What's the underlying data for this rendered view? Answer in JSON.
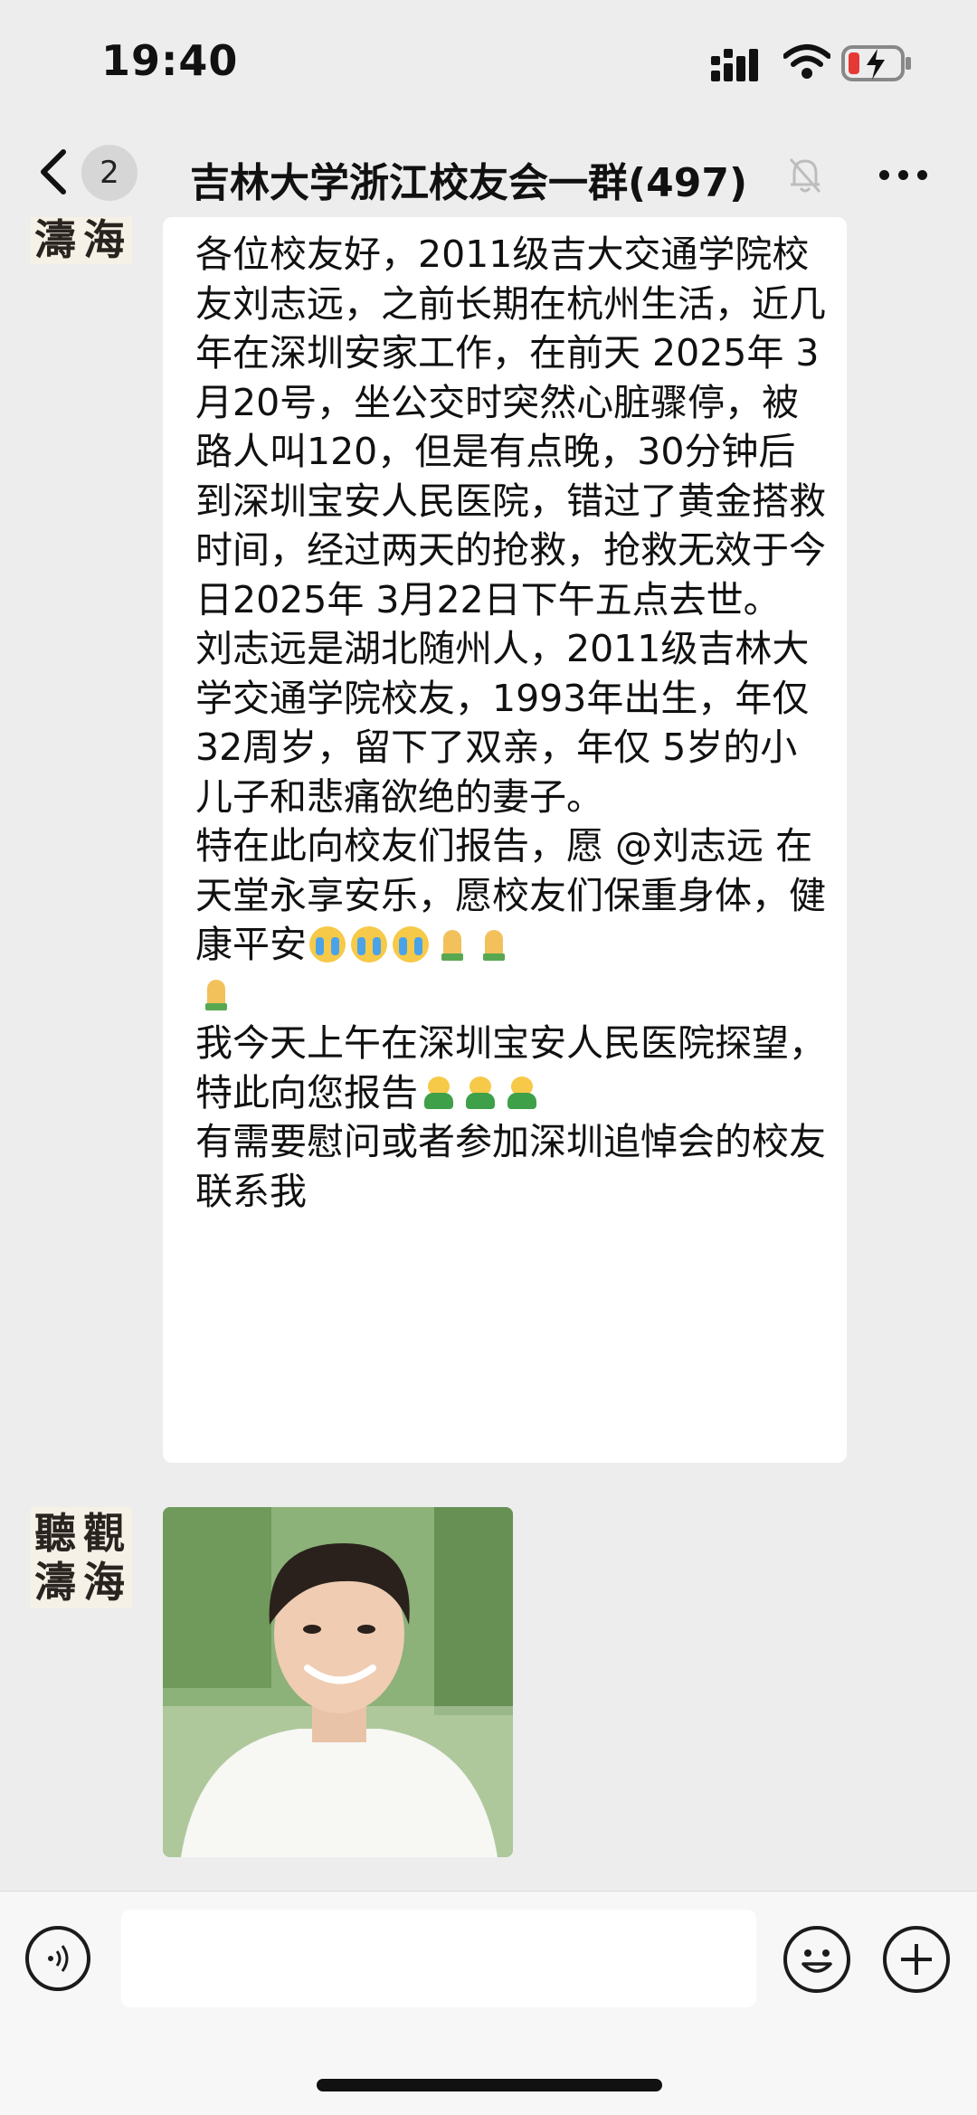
{
  "status_bar": {
    "time": "19:40"
  },
  "header": {
    "back_icon": "chevron-left-icon",
    "unread_count": "2",
    "title": "吉林大学浙江校友会一群(497)",
    "mute_icon": "bell-slash-icon",
    "more_icon": "ellipsis-icon"
  },
  "messages": {
    "avatar_text": [
      "聽",
      "觀",
      "濤",
      "海"
    ],
    "text_message": {
      "p1": "各位校友好，2011级吉大交通学院校友刘志远，之前长期在杭州生活，近几年在深圳安家工作，在前天 2025年 3月20号，坐公交时突然心脏骤停，被路人叫120，但是有点晚，30分钟后到深圳宝安人民医院，错过了黄金搭救时间，经过两天的抢救，抢救无效于今日2025年 3月22日下午五点去世。",
      "p2": "刘志远是湖北随州人，2011级吉林大学交通学院校友，1993年出生，年仅 32周岁，留下了双亲，年仅 5岁的小儿子和悲痛欲绝的妻子。",
      "p3": "特在此向校友们报告，愿 @刘志远 在天堂永享安乐，愿校友们保重身体，健康平安",
      "p4": "我今天上午在深圳宝安人民医院探望，特此向您报告",
      "p5": "有需要慰问或者参加深圳追悼会的校友联系我"
    },
    "emoji_names": [
      "loudly-crying-face",
      "folded-hands",
      "bowing-person"
    ]
  },
  "input_bar": {
    "voice_icon": "voice-icon",
    "emoji_icon": "smiley-icon",
    "plus_icon": "plus-circle-icon",
    "value": ""
  }
}
